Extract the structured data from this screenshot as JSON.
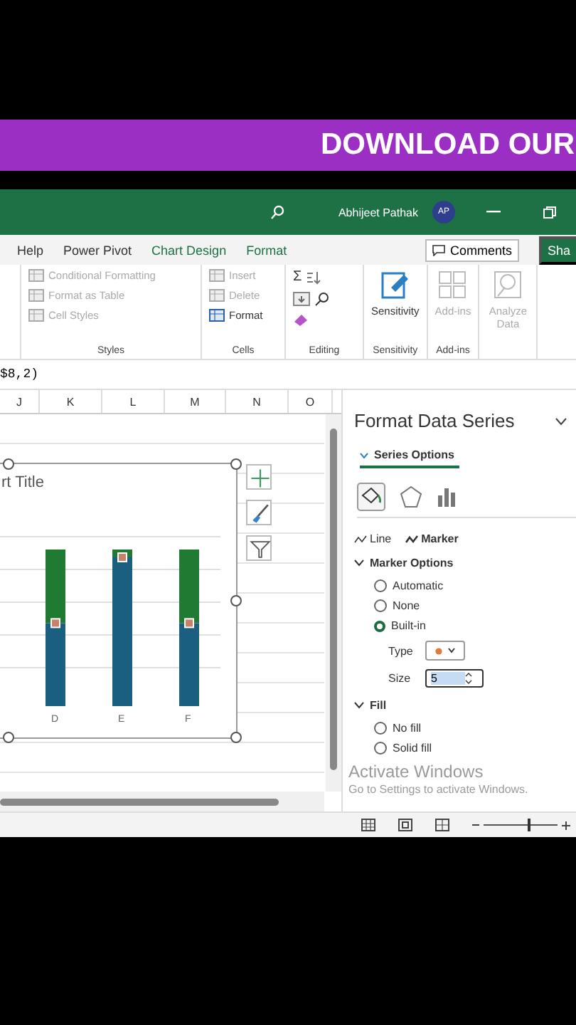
{
  "banner": {
    "text": "DOWNLOAD OUR"
  },
  "title_bar": {
    "user": "Abhijeet Pathak",
    "avatar": "AP"
  },
  "ribbon_tabs": [
    {
      "label": "Help",
      "kind": "normal"
    },
    {
      "label": "Power Pivot",
      "kind": "normal"
    },
    {
      "label": "Chart Design",
      "kind": "contextual"
    },
    {
      "label": "Format",
      "kind": "contextual"
    }
  ],
  "comments_button": "Comments",
  "share_button": "Sha",
  "ribbon_groups": [
    {
      "label": "Styles",
      "items": [
        {
          "label": "Conditional Formatting",
          "disabled": true
        },
        {
          "label": "Format as Table",
          "disabled": true
        },
        {
          "label": "Cell Styles",
          "disabled": true
        }
      ]
    },
    {
      "label": "Cells",
      "items": [
        {
          "label": "Insert",
          "disabled": true
        },
        {
          "label": "Delete",
          "disabled": true
        },
        {
          "label": "Format",
          "disabled": false
        }
      ]
    },
    {
      "label": "Editing",
      "symbol": "Σ"
    },
    {
      "label": "Sensitivity",
      "items": [
        {
          "label": "Sensitivity",
          "disabled": false
        }
      ]
    },
    {
      "label": "Add-ins",
      "items": [
        {
          "label": "Add-ins",
          "disabled": true
        }
      ]
    },
    {
      "items": [
        {
          "label": "Analyze Data",
          "disabled": true
        }
      ]
    }
  ],
  "formula": "$8,2)",
  "columns": [
    "J",
    "K",
    "L",
    "M",
    "N",
    "O"
  ],
  "chart": {
    "title": "rt Title",
    "categories": [
      "D",
      "E",
      "F"
    ]
  },
  "pane": {
    "title": "Format Data Series",
    "tab": "Series Options",
    "subtabs": [
      {
        "label": "Line",
        "selected": false
      },
      {
        "label": "Marker",
        "selected": true
      }
    ],
    "sections": [
      {
        "title": "Marker Options",
        "expanded": true,
        "options": [
          {
            "label": "Automatic",
            "selected": false
          },
          {
            "label": "None",
            "selected": false
          },
          {
            "label": "Built-in",
            "selected": true
          }
        ],
        "type_label": "Type",
        "size_label": "Size",
        "size_value": "5"
      },
      {
        "title": "Fill",
        "expanded": true,
        "options": [
          {
            "label": "No fill",
            "selected": false
          },
          {
            "label": "Solid fill",
            "selected": false
          }
        ]
      }
    ]
  },
  "zoom": {
    "level": 0.62
  },
  "watermark": {
    "title": "Activate Windows",
    "text": "Go to Settings to activate Windows."
  }
}
